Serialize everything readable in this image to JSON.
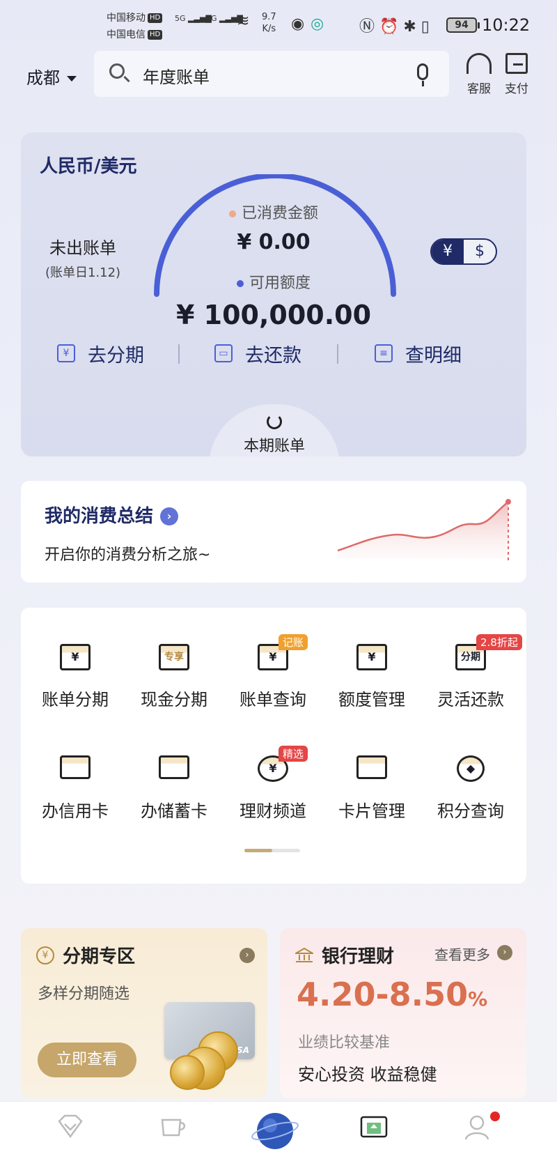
{
  "status_bar": {
    "carrier1": "中国移动",
    "carrier2": "中国电信",
    "hd": "HD",
    "net1": "5G",
    "net2": "4G",
    "speed_value": "9.7",
    "speed_unit": "K/s",
    "battery": "94",
    "time": "10:22"
  },
  "header": {
    "city": "成都",
    "search_text": "年度账单",
    "service_label": "客服",
    "pay_label": "支付"
  },
  "bill_card": {
    "title": "人民币/美元",
    "unbilled": "未出账单",
    "bill_day": "(账单日1.12)",
    "spent_label": "已消费金额",
    "spent_value": "¥ 0.00",
    "available_label": "可用额度",
    "available_value": "¥ 100,000.00",
    "currency_rmb": "¥",
    "currency_usd": "$",
    "actions": [
      {
        "label": "去分期",
        "icon": "yuan-doc-icon"
      },
      {
        "label": "去还款",
        "icon": "wallet-icon"
      },
      {
        "label": "查明细",
        "icon": "search-doc-icon"
      }
    ],
    "this_bill": "本期账单"
  },
  "summary": {
    "title": "我的消费总结",
    "subtitle": "开启你的消费分析之旅~"
  },
  "services": {
    "row1": [
      {
        "label": "账单分期",
        "glyph": "¥"
      },
      {
        "label": "现金分期",
        "glyph": "专享"
      },
      {
        "label": "账单查询",
        "glyph": "¥",
        "tag": "记账"
      },
      {
        "label": "额度管理",
        "glyph": "¥"
      },
      {
        "label": "灵活还款",
        "glyph": "分期",
        "tag": "2.8折起"
      }
    ],
    "row2": [
      {
        "label": "办信用卡"
      },
      {
        "label": "办储蓄卡"
      },
      {
        "label": "理财频道",
        "glyph": "¥",
        "tag": "精选"
      },
      {
        "label": "卡片管理"
      },
      {
        "label": "积分查询"
      }
    ]
  },
  "promo_installment": {
    "title": "分期专区",
    "subtitle": "多样分期随选",
    "button": "立即查看",
    "card_brand": "VISA",
    "icon_glyph": "¥"
  },
  "promo_wealth": {
    "title": "银行理财",
    "more": "查看更多",
    "rate": "4.20-8.50",
    "rate_unit": "%",
    "desc": "业绩比较基准",
    "slogan": "安心投资 收益稳健"
  },
  "colors": {
    "accent_blue": "#4a5fd6",
    "navy": "#1f2a66",
    "gold": "#c6a66a",
    "rate_orange": "#d9704f",
    "badge_red": "#e52424"
  }
}
